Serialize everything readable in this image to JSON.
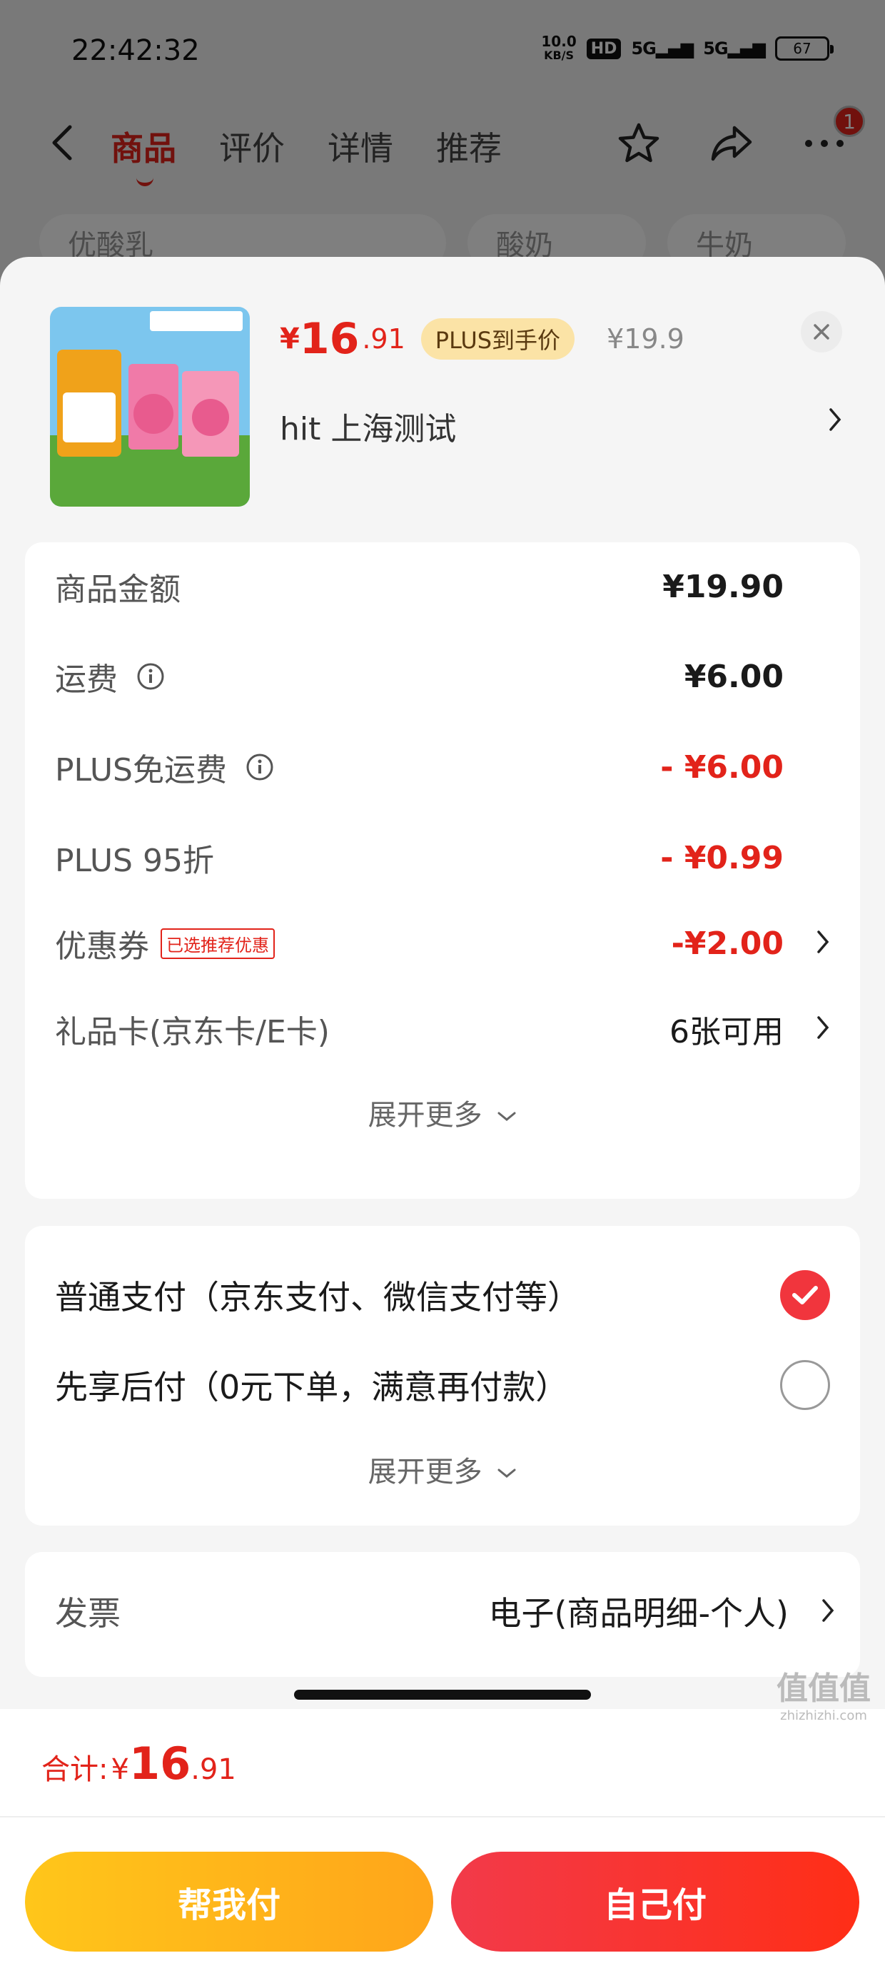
{
  "status_bar": {
    "time": "22:42:32",
    "net_speed": "10.0",
    "net_unit": "KB/S",
    "hd": "HD",
    "sig1": "5G",
    "sig2": "5G",
    "battery": "67"
  },
  "nav": {
    "tabs": [
      "商品",
      "评价",
      "详情",
      "推荐"
    ],
    "badge": "1"
  },
  "search_row": {
    "pills": [
      "优酸乳",
      "酸奶",
      "牛奶"
    ]
  },
  "product": {
    "price_currency": "¥",
    "price_int": "16",
    "price_dec": ".91",
    "plus_tag": "PLUS到手价",
    "original_price": "¥19.9",
    "address": "hit  上海测试"
  },
  "fees": [
    {
      "label": "商品金额",
      "value": "¥19.90",
      "red": false
    },
    {
      "label": "运费",
      "value": "¥6.00",
      "red": false
    },
    {
      "label": "PLUS免运费",
      "value": "- ¥6.00",
      "red": true
    },
    {
      "label": "PLUS 95折",
      "value": "- ¥0.99",
      "red": true
    },
    {
      "label": "优惠券",
      "chip": "已选推荐优惠",
      "value": "-¥2.00",
      "red": true
    },
    {
      "label": "礼品卡(京东卡/E卡)",
      "value": "6张可用",
      "red": false
    }
  ],
  "fee_expand": "展开更多",
  "payment": {
    "options": [
      {
        "label": "普通支付（京东支付、微信支付等）",
        "selected": true
      },
      {
        "label": "先享后付（0元下单，满意再付款）",
        "selected": false
      }
    ],
    "expand": "展开更多"
  },
  "invoice": {
    "label": "发票",
    "value": "电子(商品明细-个人)"
  },
  "bottom": {
    "total_label": "合计:",
    "total_currency": "¥",
    "total_int": "16",
    "total_dec": ".91",
    "help_pay": "帮我付",
    "self_pay": "自己付"
  },
  "watermark": {
    "text": "值值值",
    "sub": "zhizhizhi.com"
  },
  "colors": {
    "accent_red": "#e2231a",
    "plus_gold": "#fbe3a6",
    "help_btn": "#ffb51a",
    "self_btn": "#f5303a"
  }
}
